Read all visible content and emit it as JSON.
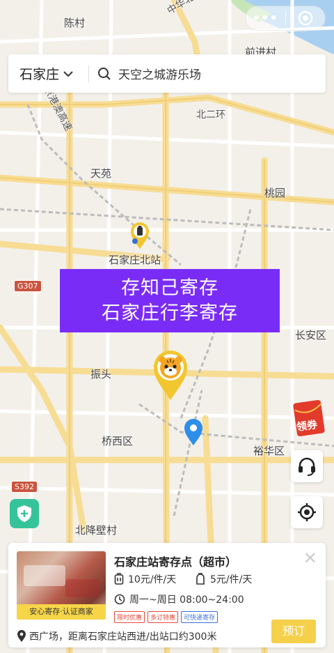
{
  "map": {
    "places": {
      "chencun": "陈村",
      "zhonghua_road": "中华北大街",
      "qianjin": "前进村",
      "highway": "京港澳高速",
      "beierhuan": "北二环",
      "tianyuan": "天苑",
      "taoyuan": "桃园",
      "north_station": "石家庄北站",
      "changan": "长安区",
      "zhentou": "振头",
      "qiaoxi": "桥西区",
      "yuhua": "裕华区",
      "beijiangbi": "北降壁村"
    },
    "shields": {
      "g307": "G307",
      "s392": "S392"
    }
  },
  "capsule": {
    "more_icon": "more-dots-icon",
    "close_icon": "mini-program-close-icon"
  },
  "search": {
    "city": "石家庄",
    "query": "天空之城游乐场"
  },
  "banner": {
    "line1": "存知己寄存",
    "line2": "石家庄行李寄存"
  },
  "coupon": {
    "label": "领券"
  },
  "card": {
    "name": "石家庄站寄存点（超市）",
    "thumb_badge": "安心寄存·认证商家",
    "price_large": "10元/件/天",
    "price_small": "5元/件/天",
    "hours": "周一~周日 08:00~24:00",
    "tags": [
      "限时优惠",
      "多订特惠",
      "可快递寄存"
    ],
    "address": "西广场，距离石家庄站西进/出站口约300米",
    "book_label": "预订"
  },
  "colors": {
    "banner": "#7a2cf7",
    "book": "#f5d04a",
    "shield": "#35c49a",
    "marker": "#f2c62f"
  }
}
